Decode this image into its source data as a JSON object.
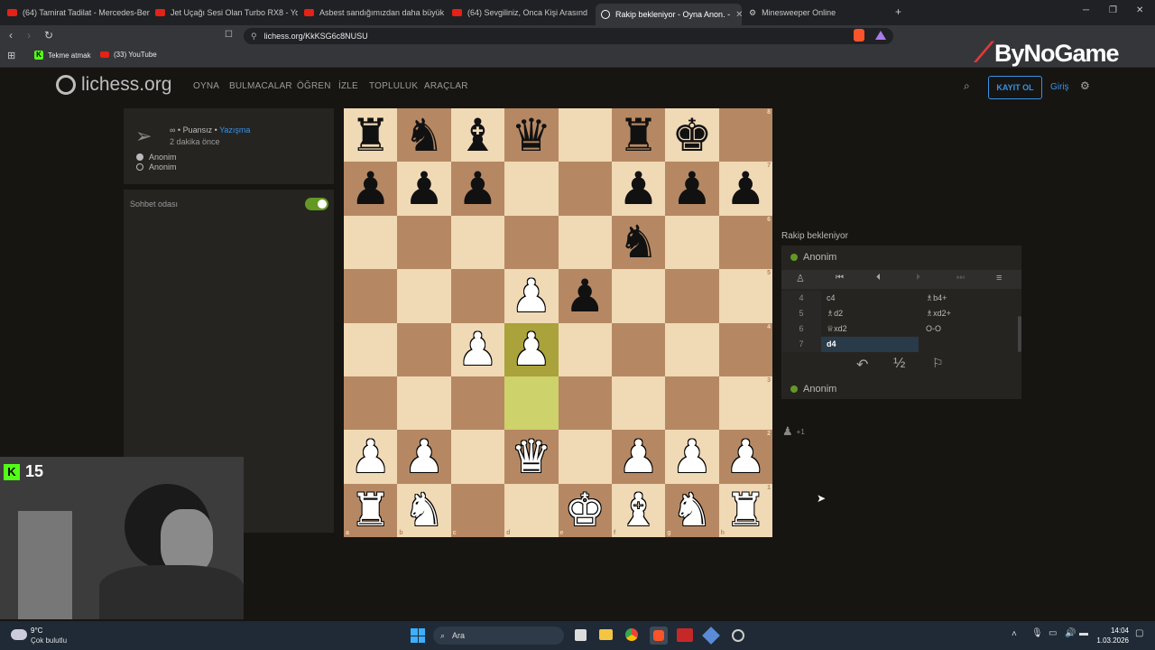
{
  "browser": {
    "tabs": [
      {
        "label": "(64) Tamirat Tadilat - Mercedes-Benz"
      },
      {
        "label": "Jet Uçağı Sesi Olan Turbo RX8 - YouT"
      },
      {
        "label": "Asbest sandığımızdan daha büyük bi"
      },
      {
        "label": "(64) Sevgiliniz, Onca Kişi Arasından M"
      },
      {
        "label": "Rakip bekleniyor - Oyna Anon. -"
      },
      {
        "label": "Minesweeper Online"
      }
    ],
    "url": "lichess.org/KkKSG6c8NUSU",
    "bookmarks": [
      "Tekme atmak",
      "(33) YouTube"
    ]
  },
  "overlay": {
    "brand": "ByNoGame",
    "kick_count": "15"
  },
  "site": {
    "logo": "lichess.org",
    "nav": [
      "OYNA",
      "BULMACALAR",
      "ÖĞREN",
      "İZLE",
      "TOPLULUK",
      "ARAÇLAR"
    ],
    "register": "KAYIT OL",
    "login": "Giriş"
  },
  "game_info": {
    "time_control": "∞ • Puansız •",
    "variant_link": "Yazışma",
    "started": "2 dakika önce",
    "player_white": "Anonim",
    "player_black": "Anonim"
  },
  "chat": {
    "label": "Sohbet odası",
    "enabled": true
  },
  "board": {
    "highlight": [
      "d3",
      "d4"
    ],
    "files": [
      "a",
      "b",
      "c",
      "d",
      "e",
      "f",
      "g",
      "h"
    ],
    "ranks": [
      "8",
      "7",
      "6",
      "5",
      "4",
      "3",
      "2",
      "1"
    ],
    "rows": [
      [
        "bR",
        "bN",
        "bB",
        "bQ",
        "",
        "bR",
        "bK",
        ""
      ],
      [
        "bP",
        "bP",
        "bP",
        "",
        "",
        "bP",
        "bP",
        "bP"
      ],
      [
        "",
        "",
        "",
        "",
        "",
        "bN",
        "",
        ""
      ],
      [
        "",
        "",
        "",
        "wP",
        "bP",
        "",
        "",
        ""
      ],
      [
        "",
        "",
        "wP",
        "wP",
        "",
        "",
        "",
        ""
      ],
      [
        "",
        "",
        "",
        "",
        "",
        "",
        "",
        ""
      ],
      [
        "wP",
        "wP",
        "",
        "wQ",
        "",
        "wP",
        "wP",
        "wP"
      ],
      [
        "wR",
        "wN",
        "",
        "",
        "wK",
        "wB",
        "wN",
        "wR"
      ]
    ]
  },
  "right_panel": {
    "status": "Rakip bekleniyor",
    "top_player": "Anonim",
    "bottom_player": "Anonim",
    "moves": [
      {
        "num": "4",
        "white": "c4",
        "black": "♗b4+"
      },
      {
        "num": "5",
        "white": "♗d2",
        "black": "♗xd2+"
      },
      {
        "num": "6",
        "white": "♕xd2",
        "black": "O-O"
      },
      {
        "num": "7",
        "white": "d4",
        "black": ""
      }
    ],
    "material": "+1",
    "draw_symbol": "½"
  },
  "taskbar": {
    "weather_temp": "9°C",
    "weather_desc": "Çok bulutlu",
    "search": "Ara",
    "time": "14:04",
    "date": "1.03.2026"
  }
}
